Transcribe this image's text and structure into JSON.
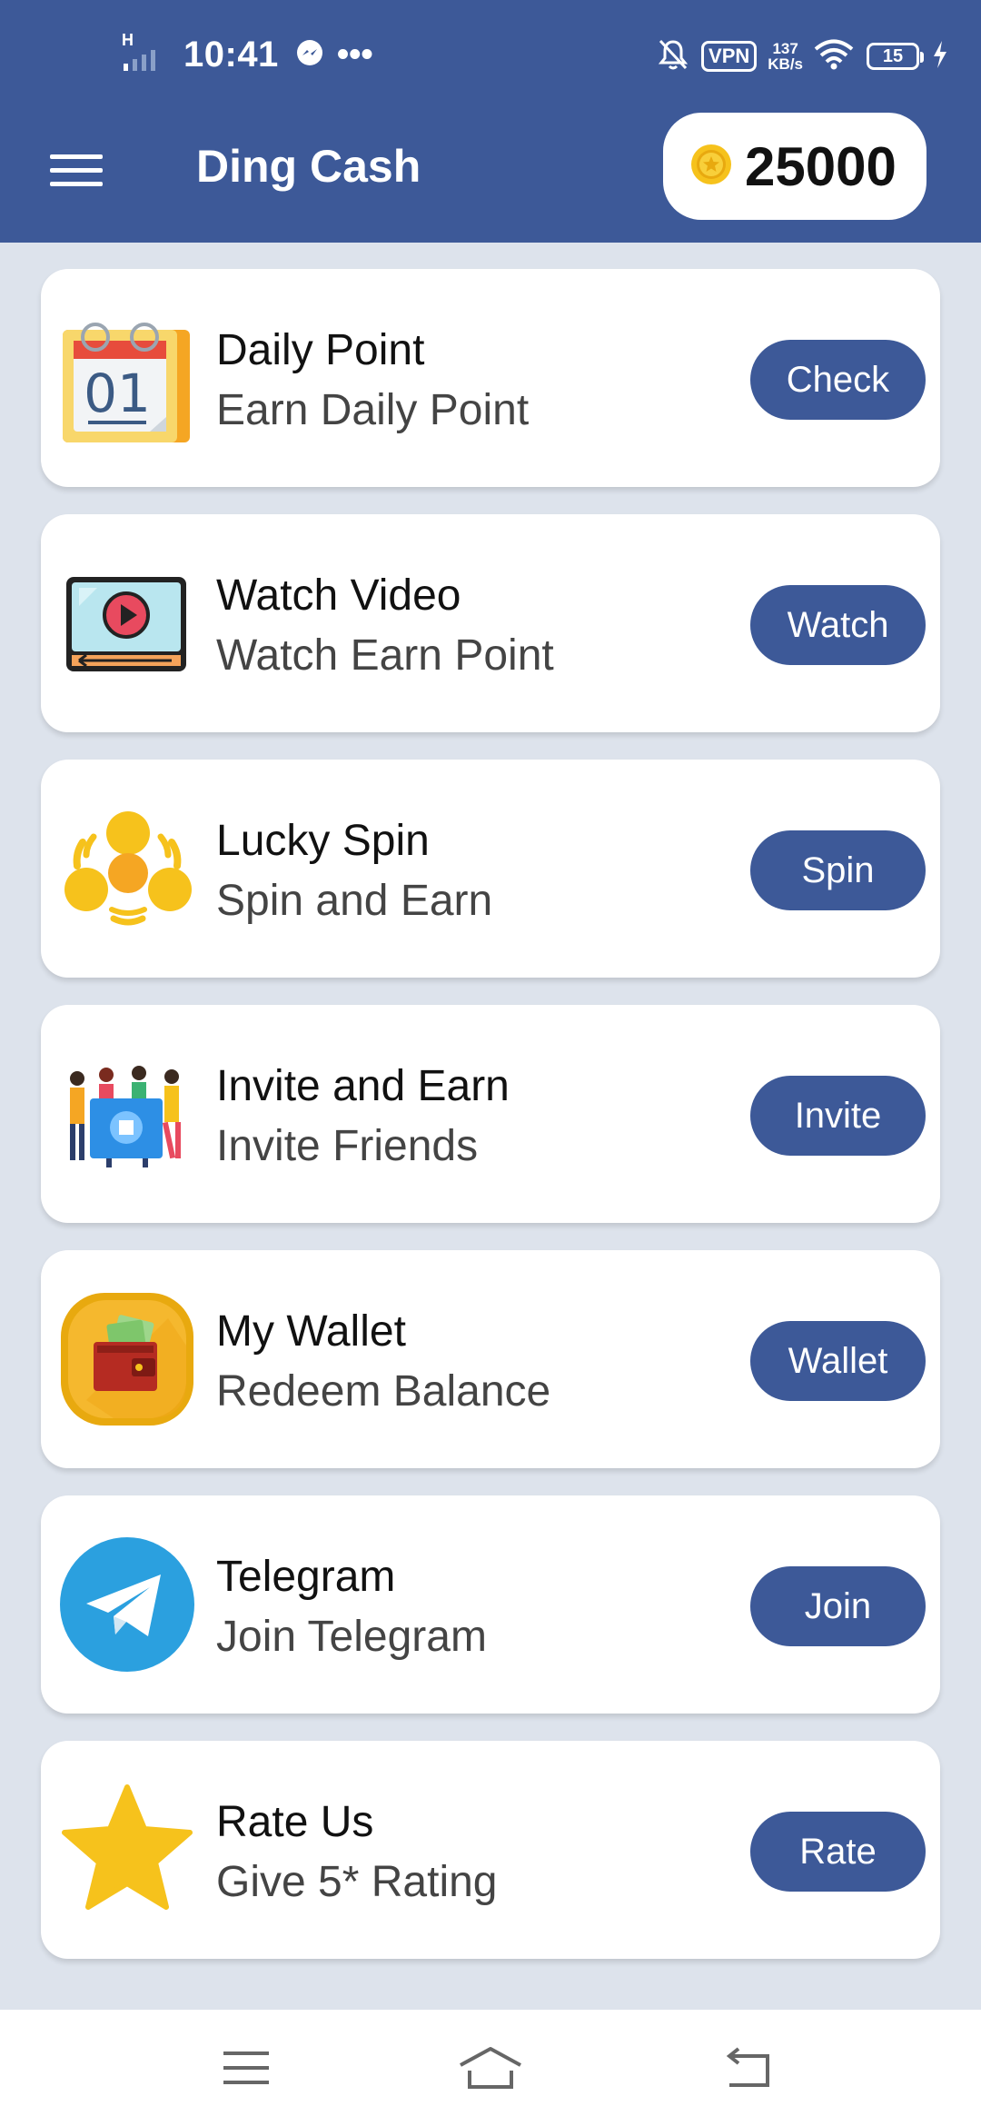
{
  "status_bar": {
    "network": "H",
    "time": "10:41",
    "more": "•••",
    "vpn": "VPN",
    "speed_value": "137",
    "speed_unit": "KB/s",
    "battery": "15"
  },
  "app_bar": {
    "title": "Ding Cash",
    "coins": "25000"
  },
  "items": [
    {
      "title": "Daily Point",
      "subtitle": "Earn Daily Point",
      "button": "Check",
      "icon": "calendar-icon",
      "calendar_number": "01"
    },
    {
      "title": "Watch Video",
      "subtitle": "Watch Earn Point",
      "button": "Watch",
      "icon": "video-player-icon"
    },
    {
      "title": "Lucky Spin",
      "subtitle": "Spin and Earn",
      "button": "Spin",
      "icon": "spinner-icon"
    },
    {
      "title": "Invite and Earn",
      "subtitle": "Invite Friends",
      "button": "Invite",
      "icon": "people-group-icon"
    },
    {
      "title": "My Wallet",
      "subtitle": "Redeem Balance",
      "button": "Wallet",
      "icon": "wallet-icon"
    },
    {
      "title": "Telegram",
      "subtitle": "Join Telegram",
      "button": "Join",
      "icon": "telegram-icon"
    },
    {
      "title": "Rate Us",
      "subtitle": "Give 5* Rating",
      "button": "Rate",
      "icon": "star-icon"
    }
  ],
  "colors": {
    "primary": "#3d5998",
    "background": "#dde3ec",
    "card": "#ffffff",
    "coin": "#f6c21c"
  }
}
